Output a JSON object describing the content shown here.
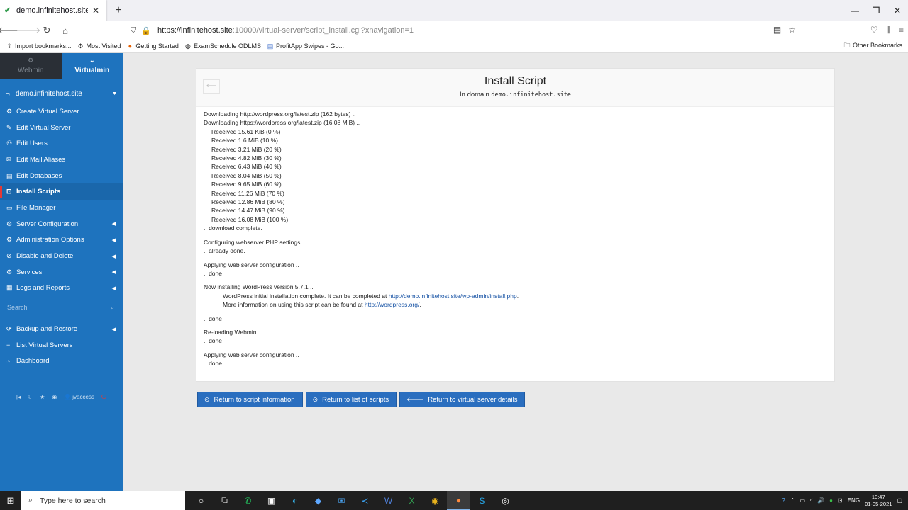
{
  "browser": {
    "tab_title": "demo.infinitehost.site - Inst",
    "tab_close": "✕",
    "new_tab": "+",
    "url_host": "https://infinitehost.site",
    "url_path": ":10000/virtual-server/script_install.cgi?xnavigation=1",
    "window_controls": [
      "—",
      "❐",
      "✕"
    ]
  },
  "bookmarks": {
    "items": [
      {
        "label": "Import bookmarks...",
        "icon": "import-icon"
      },
      {
        "label": "Most Visited",
        "icon": "gear-icon"
      },
      {
        "label": "Getting Started",
        "icon": "firefox-icon"
      },
      {
        "label": "ExamSchedule ODLMS",
        "icon": "globe-icon"
      },
      {
        "label": "ProfitApp Swipes - Go...",
        "icon": "doc-icon"
      }
    ],
    "other": "Other Bookmarks"
  },
  "sidebar": {
    "switch_webmin": "Webmin",
    "switch_virtualmin": "Virtualmin",
    "domain": "demo.infinitehost.site",
    "items_top": [
      {
        "label": "Create Virtual Server",
        "icon": "gear-icon",
        "arrow": ""
      },
      {
        "label": "Edit Virtual Server",
        "icon": "edit-icon",
        "arrow": ""
      },
      {
        "label": "Edit Users",
        "icon": "users-icon",
        "arrow": ""
      },
      {
        "label": "Edit Mail Aliases",
        "icon": "mail-icon",
        "arrow": ""
      },
      {
        "label": "Edit Databases",
        "icon": "database-icon",
        "arrow": ""
      },
      {
        "label": "Install Scripts",
        "icon": "scripts-icon",
        "arrow": ""
      },
      {
        "label": "File Manager",
        "icon": "file-icon",
        "arrow": ""
      },
      {
        "label": "Server Configuration",
        "icon": "cogs-icon",
        "arrow": "◀"
      },
      {
        "label": "Administration Options",
        "icon": "admin-icon",
        "arrow": "◀"
      },
      {
        "label": "Disable and Delete",
        "icon": "disable-icon",
        "arrow": "◀"
      },
      {
        "label": "Services",
        "icon": "services-icon",
        "arrow": "◀"
      },
      {
        "label": "Logs and Reports",
        "icon": "logs-icon",
        "arrow": "◀"
      }
    ],
    "search_placeholder": "Search",
    "items_bottom": [
      {
        "label": "Backup and Restore",
        "icon": "backup-icon",
        "arrow": "◀"
      },
      {
        "label": "List Virtual Servers",
        "icon": "list-icon",
        "arrow": ""
      },
      {
        "label": "Dashboard",
        "icon": "dashboard-icon",
        "arrow": ""
      }
    ],
    "user": "jvaccess"
  },
  "panel": {
    "title": "Install Script",
    "subtitle_prefix": "In domain",
    "subtitle_domain": "demo.infinitehost.site"
  },
  "log": {
    "download": [
      "Downloading http://wordpress.org/latest.zip (162 bytes) ..",
      "Downloading https://wordpress.org/latest.zip (16.08 MiB) .."
    ],
    "received": [
      "Received 15.61 KiB (0 %)",
      "Received 1.6 MiB (10 %)",
      "Received 3.21 MiB (20 %)",
      "Received 4.82 MiB (30 %)",
      "Received 6.43 MiB (40 %)",
      "Received 8.04 MiB (50 %)",
      "Received 9.65 MiB (60 %)",
      "Received 11.26 MiB (70 %)",
      "Received 12.86 MiB (80 %)",
      "Received 14.47 MiB (90 %)",
      "Received 16.08 MiB (100 %)"
    ],
    "download_complete": ".. download complete.",
    "configuring": "Configuring webserver PHP settings ..",
    "already_done": ".. already done.",
    "applying1": "Applying web server configuration ..",
    "done": ".. done",
    "installing": "Now installing WordPress version 5.7.1 ..",
    "complete_prefix": "WordPress initial installation complete. It can be completed at",
    "complete_link": "http://demo.infinitehost.site/wp-admin/install.php",
    "more_prefix": "More information on using this script can be found at",
    "more_link": "http://wordpress.org/",
    "reloading": "Re-loading Webmin ..",
    "applying2": "Applying web server configuration .."
  },
  "actions": [
    {
      "label": "Return to script information",
      "icon": "info-icon"
    },
    {
      "label": "Return to list of scripts",
      "icon": "list-icon"
    },
    {
      "label": "Return to virtual server details",
      "icon": "arrow-left-icon"
    }
  ],
  "taskbar": {
    "search_placeholder": "Type here to search",
    "lang": "ENG",
    "time": "10:47",
    "date": "01-05-2021"
  }
}
